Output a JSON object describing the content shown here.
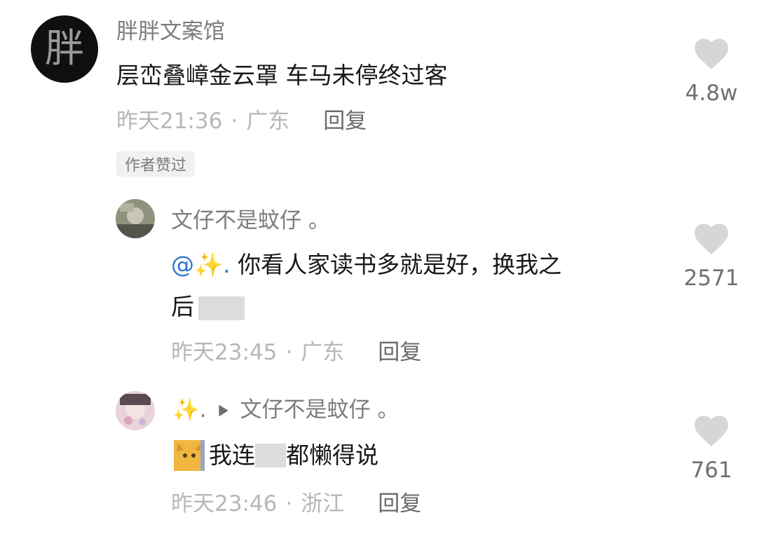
{
  "comments": [
    {
      "author": "胖胖文案馆",
      "avatar_text": "胖",
      "text": "层峦叠嶂金云罩 车马未停终过客",
      "time": "昨天21:36",
      "location": "广东",
      "reply": "回复",
      "badge": "作者赞过",
      "likes": "4.8w"
    },
    {
      "author": "文仔不是蚊仔 。",
      "mention": "@",
      "mention_name": ".",
      "text_line1": "你看人家读书多就是好，换我之",
      "text_line2": "后",
      "time": "昨天23:45",
      "location": "广东",
      "reply": "回复",
      "likes": "2571"
    },
    {
      "author_from": ".",
      "reply_to": "文仔不是蚊仔 。",
      "text_a": "我连",
      "text_b": "都懒得说",
      "time": "昨天23:46",
      "location": "浙江",
      "reply": "回复",
      "likes": "761"
    }
  ],
  "meta_separator": "·",
  "icons": {
    "like": "heart-icon",
    "reply_arrow": "triangle-right-icon",
    "sparkle": "sparkle-icon",
    "emoji": "cat-emoji-icon"
  },
  "colors": {
    "mention": "#2f75cf",
    "meta": "#b7b7b7",
    "heart": "#d6d6d6"
  }
}
